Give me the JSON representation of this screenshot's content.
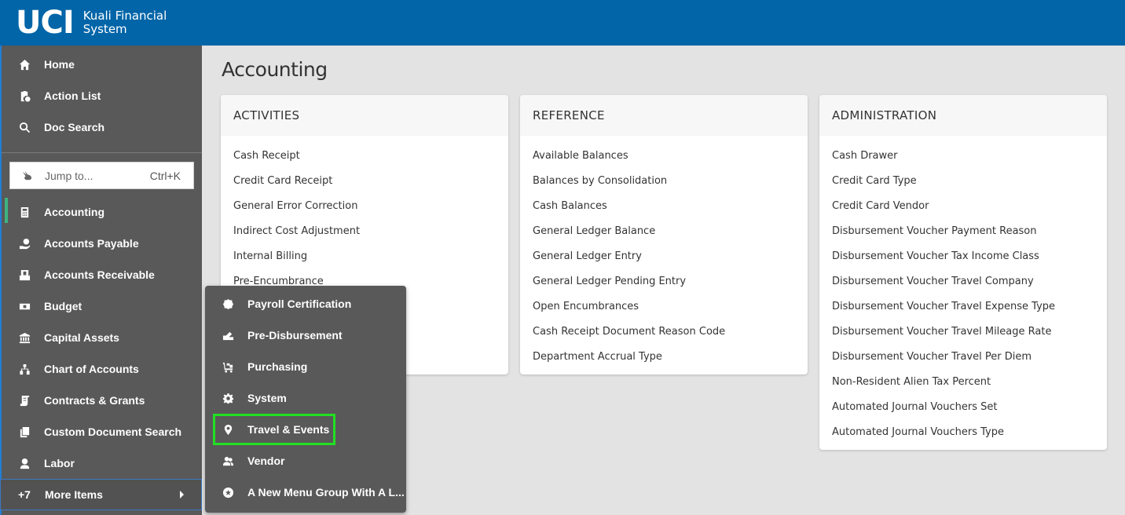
{
  "header": {
    "logo": "UCI",
    "app_title_line1": "Kuali Financial",
    "app_title_line2": "System"
  },
  "sidebar": {
    "top_items": [
      {
        "label": "Home",
        "icon": "home-icon"
      },
      {
        "label": "Action List",
        "icon": "clipboard-check-icon"
      },
      {
        "label": "Doc Search",
        "icon": "search-icon"
      }
    ],
    "jump": {
      "label": "Jump to...",
      "shortcut": "Ctrl+K",
      "icon": "rabbit-icon"
    },
    "items": [
      {
        "label": "Accounting",
        "icon": "calculator-icon",
        "active": true
      },
      {
        "label": "Accounts Payable",
        "icon": "hand-coin-icon"
      },
      {
        "label": "Accounts Receivable",
        "icon": "invoice-icon"
      },
      {
        "label": "Budget",
        "icon": "money-stack-icon"
      },
      {
        "label": "Capital Assets",
        "icon": "bank-icon"
      },
      {
        "label": "Chart of Accounts",
        "icon": "sitemap-icon"
      },
      {
        "label": "Contracts & Grants",
        "icon": "scroll-icon"
      },
      {
        "label": "Custom Document Search",
        "icon": "copy-icon"
      },
      {
        "label": "Labor",
        "icon": "worker-icon"
      }
    ],
    "more": {
      "count": "+7",
      "label": "More Items"
    }
  },
  "flyout": {
    "items": [
      {
        "label": "Payroll Certification",
        "icon": "badge-check-icon"
      },
      {
        "label": "Pre-Disbursement",
        "icon": "signature-icon"
      },
      {
        "label": "Purchasing",
        "icon": "cart-icon"
      },
      {
        "label": "System",
        "icon": "gear-icon"
      },
      {
        "label": "Travel & Events",
        "icon": "map-marker-icon",
        "highlighted": true
      },
      {
        "label": "Vendor",
        "icon": "users-icon"
      },
      {
        "label": "A New Menu Group With A L...",
        "icon": "star-circle-icon"
      }
    ]
  },
  "main": {
    "title": "Accounting",
    "cards": [
      {
        "title": "ACTIVITIES",
        "links": [
          "Cash Receipt",
          "Credit Card Receipt",
          "General Error Correction",
          "Indirect Cost Adjustment",
          "Internal Billing",
          "Pre-Encumbrance"
        ]
      },
      {
        "title": "REFERENCE",
        "links": [
          "Available Balances",
          "Balances by Consolidation",
          "Cash Balances",
          "General Ledger Balance",
          "General Ledger Entry",
          "General Ledger Pending Entry",
          "Open Encumbrances",
          "Cash Receipt Document Reason Code",
          "Department Accrual Type"
        ]
      },
      {
        "title": "ADMINISTRATION",
        "links": [
          "Cash Drawer",
          "Credit Card Type",
          "Credit Card Vendor",
          "Disbursement Voucher Payment Reason",
          "Disbursement Voucher Tax Income Class",
          "Disbursement Voucher Travel Company",
          "Disbursement Voucher Travel Expense Type",
          "Disbursement Voucher Travel Mileage Rate",
          "Disbursement Voucher Travel Per Diem",
          "Non-Resident Alien Tax Percent",
          "Automated Journal Vouchers Set",
          "Automated Journal Vouchers Type"
        ]
      }
    ]
  },
  "colors": {
    "header": "#0165a8",
    "sidebar": "#595959",
    "active_indicator": "#3fb37f",
    "highlight_box": "#22e022"
  }
}
